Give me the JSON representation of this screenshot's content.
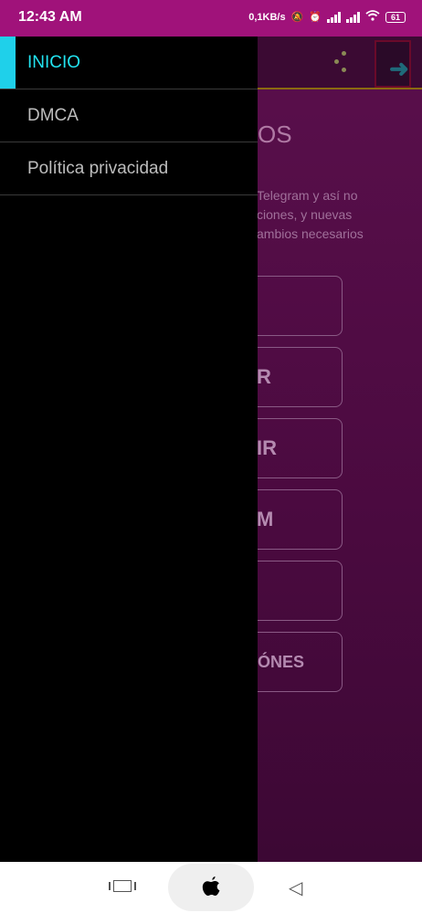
{
  "status_bar": {
    "time": "12:43 AM",
    "net_speed": "0,1KB/s",
    "battery": "61"
  },
  "drawer": {
    "items": [
      {
        "label": "INICIO",
        "active": true
      },
      {
        "label": "DMCA",
        "active": false
      },
      {
        "label": "Política privacidad",
        "active": false
      }
    ]
  },
  "background": {
    "heading_partial": "OS",
    "paragraph_partial": "Telegram y así no\nciones, y nuevas\nambios necesarios",
    "buttons": [
      "",
      "R",
      "IR",
      "M",
      "",
      "ACIÓNES"
    ]
  },
  "colors": {
    "accent": "#1fd0ea",
    "status_bar": "#a0127a"
  }
}
